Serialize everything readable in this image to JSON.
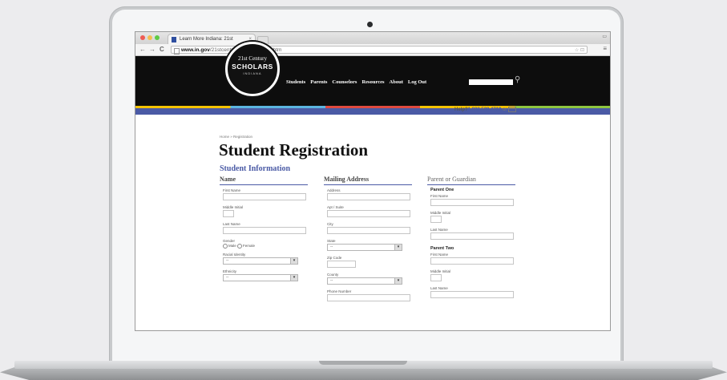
{
  "browser": {
    "tab_title": "Learn More Indiana: 21st",
    "tab_close": "×",
    "url_domain": "www.in.gov",
    "url_path": "/21stcenturyscholars/index.htm",
    "url_icons": "☆ ⊡",
    "back": "←",
    "forward": "→",
    "reload": "C",
    "menu": "≡",
    "window_controls": "▭"
  },
  "site": {
    "logo": {
      "line1": "21st Century",
      "line2": "SCHOLARS",
      "line3": "INDIANA"
    },
    "nav": [
      "Students",
      "Parents",
      "Counselors",
      "Resources",
      "About",
      "Log Out"
    ],
    "search_icon": "⚲",
    "help": {
      "label": "Help?",
      "phone": "1.888.528.4719",
      "or": "or"
    }
  },
  "page": {
    "breadcrumb": "Home » Registration",
    "title": "Student Registration",
    "section": "Student Information"
  },
  "columns": {
    "name": {
      "heading": "Name",
      "first_name": "First Name",
      "middle_initial": "Middle Initial",
      "last_name": "Last Name",
      "gender": "Gender",
      "male": "Male",
      "female": "Female",
      "racial_identity": "Racial Identity",
      "racial_value": "--",
      "ethnicity": "Ethnicity",
      "ethnicity_value": "--"
    },
    "mailing": {
      "heading": "Mailing Address",
      "address": "Address",
      "apt": "Apt / Suite",
      "city": "City",
      "state": "State",
      "state_value": "--",
      "zip": "Zip Code",
      "county": "County",
      "county_value": "--",
      "phone": "Phone Number"
    },
    "guardian": {
      "heading": "Parent or Guardian",
      "parent_one": "Parent One",
      "p1_first": "First Name",
      "p1_middle": "Middle Initial",
      "p1_last": "Last Name",
      "parent_two": "Parent Two",
      "p2_first": "First Name",
      "p2_middle": "Middle Initial",
      "p2_last": "Last Name"
    }
  },
  "select_arrow": "▾",
  "colors": {
    "accent": "#4a5aa5",
    "header": "#0d0d0d"
  }
}
